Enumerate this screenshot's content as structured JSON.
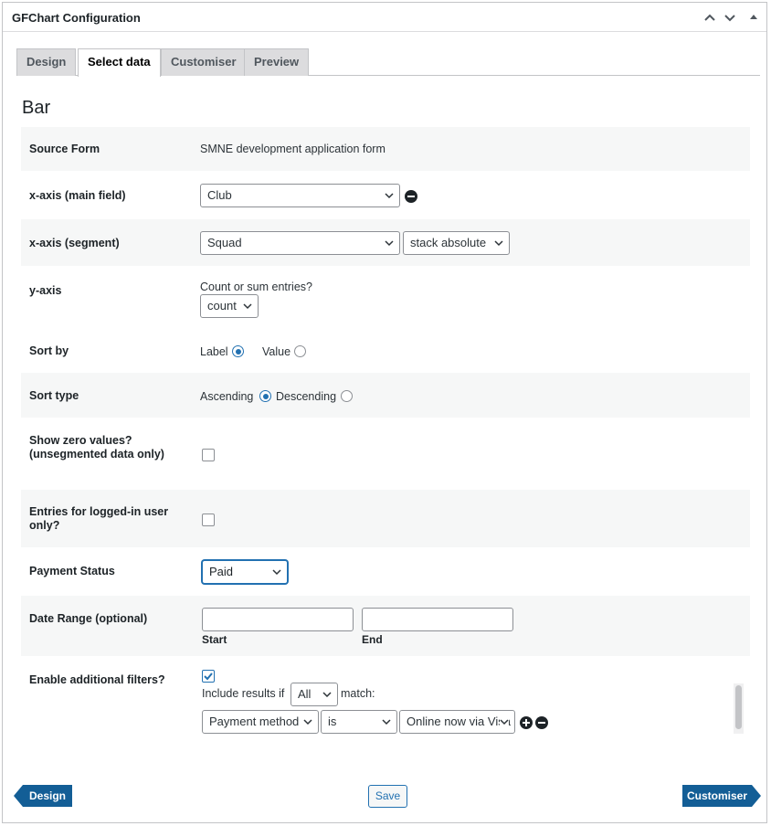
{
  "colors": {
    "accent": "#2271b1",
    "nav_button": "#135e96",
    "alt_row": "#f6f7f7"
  },
  "panel": {
    "title": "GFChart Configuration",
    "controls": [
      "chevron-up-icon",
      "chevron-down-icon",
      "triangle-up-icon"
    ]
  },
  "tabs": [
    {
      "label": "Design"
    },
    {
      "label": "Select data",
      "active": true
    },
    {
      "label": "Customiser"
    },
    {
      "label": "Preview"
    }
  ],
  "chart_type": "Bar",
  "fields": {
    "source_form": {
      "label": "Source Form",
      "value": "SMNE development application form"
    },
    "x_main": {
      "label": "x-axis (main field)",
      "value": "Club"
    },
    "x_segment": {
      "label": "x-axis (segment)",
      "value": "Squad",
      "mode": "stack absolute"
    },
    "y_axis": {
      "label": "y-axis",
      "hint": "Count or sum entries?",
      "value": "count"
    },
    "sort_by": {
      "label": "Sort by",
      "options": [
        "Label",
        "Value"
      ],
      "selected": "Label"
    },
    "sort_type": {
      "label": "Sort type",
      "options": [
        "Ascending",
        "Descending"
      ],
      "selected": "Ascending"
    },
    "show_zero": {
      "label": "Show zero values? (unsegmented data only)",
      "checked": false
    },
    "logged_in": {
      "label": "Entries for logged-in user only?",
      "checked": false
    },
    "payment_status": {
      "label": "Payment Status",
      "value": "Paid"
    },
    "date_range": {
      "label": "Date Range (optional)",
      "start_label": "Start",
      "end_label": "End",
      "start": "",
      "end": ""
    },
    "filters": {
      "label": "Enable additional filters?",
      "checked": true,
      "include_prefix": "Include results if",
      "match_value": "All",
      "include_suffix": "match:",
      "rule": {
        "field": "Payment method",
        "operator": "is",
        "value": "Online now via Visa"
      }
    }
  },
  "footer": {
    "prev_label": "Design",
    "save_label": "Save",
    "next_label": "Customiser"
  }
}
